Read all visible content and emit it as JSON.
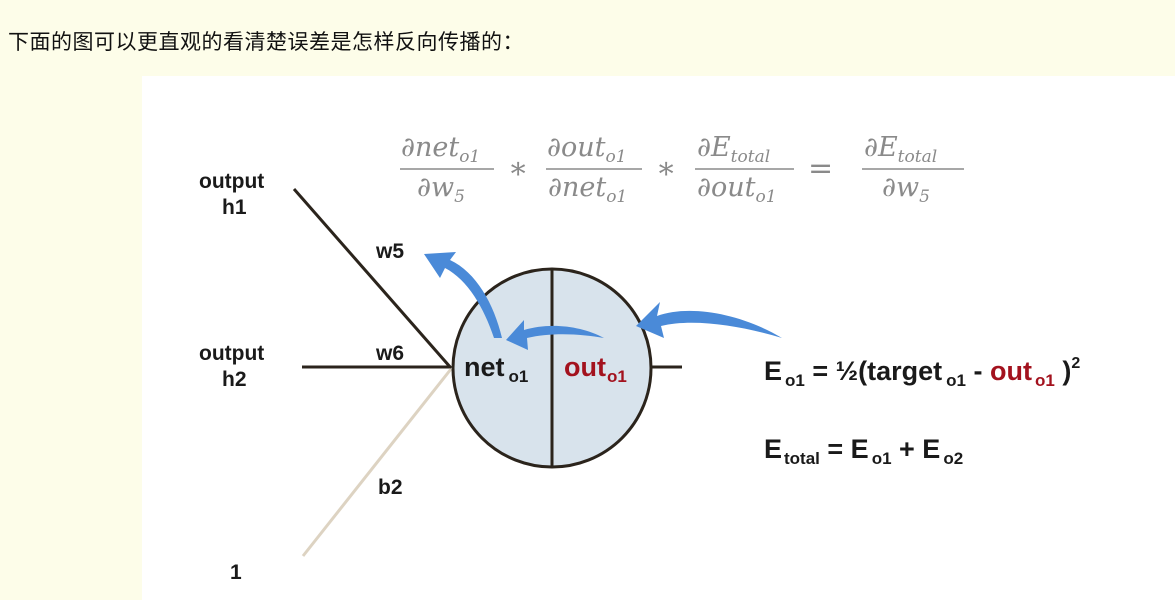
{
  "caption": "下面的图可以更直观的看清楚误差是怎样反向传播的：",
  "colors": {
    "background": "#fdfde9",
    "figure_background": "#ffffff",
    "arrow": "#4a8ad8",
    "neuron_fill": "#d8e3ec",
    "out_red": "#a3121e",
    "formula_gray": "#8a8a8a"
  },
  "formula": {
    "f1_num_a": "∂net",
    "f1_num_sub": "o1",
    "f1_den_a": "∂w",
    "f1_den_sub": "5",
    "op1": "∗",
    "f2_num_a": "∂out",
    "f2_num_sub": "o1",
    "f2_den_a": "∂net",
    "f2_den_sub": "o1",
    "op2": "∗",
    "f3_num_a": "∂E",
    "f3_num_sub": "total",
    "f3_den_a": "∂out",
    "f3_den_sub": "o1",
    "eq": "=",
    "f4_num_a": "∂E",
    "f4_num_sub": "total",
    "f4_den_a": "∂w",
    "f4_den_sub": "5"
  },
  "inputs": {
    "h1_line1": "output",
    "h1_line2": "h1",
    "h2_line1": "output",
    "h2_line2": "h2",
    "bias": "1"
  },
  "weights": {
    "w5": "w5",
    "w6": "w6",
    "b2": "b2"
  },
  "neuron": {
    "net": "net",
    "net_sub": "o1",
    "out": "out",
    "out_sub": "o1"
  },
  "equations": {
    "eo1": {
      "E": "E",
      "E_sub": "o1",
      "mid": " = ½(target",
      "target_sub": "o1",
      "minus": " - ",
      "out": "out",
      "out_sub": "o1",
      "close": " )",
      "sup": "2"
    },
    "etotal": {
      "E": "E",
      "E_sub": "total",
      "eq": "  =  E",
      "sub1": "o1",
      "plus": " + E",
      "sub2": "o2"
    }
  }
}
